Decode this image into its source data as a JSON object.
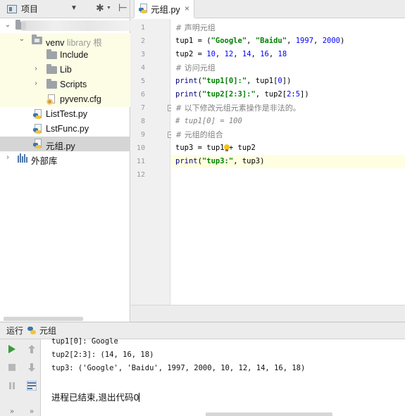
{
  "project_panel": {
    "title": "项目",
    "tree": {
      "venv": {
        "name": "venv",
        "sub": "library 根"
      },
      "include": "Include",
      "lib": "Lib",
      "scripts": "Scripts",
      "pyvenv": "pyvenv.cfg",
      "listtest": "ListTest.py",
      "lstfunc": "LstFunc.py",
      "yuanzu": "元组.py",
      "external": "外部库"
    }
  },
  "editor": {
    "tab_label": "元组.py",
    "line_numbers": [
      "1",
      "2",
      "3",
      "4",
      "5",
      "6",
      "7",
      "8",
      "9",
      "10",
      "11",
      "12"
    ],
    "current_line": 11
  },
  "run_panel": {
    "label": "运行",
    "config_name": "元组",
    "output": [
      "tup1[0]: Google",
      "tup2[2:3]: (14, 16, 18)",
      "tup3: ('Google', 'Baidu', 1997, 2000, 10, 12, 14, 16, 18)"
    ],
    "exit_message": "进程已结束,退出代码0"
  },
  "colors": {
    "string": "#008000",
    "number": "#0000ff",
    "comment": "#808080",
    "current_line": "#fffee0",
    "run_green": "#3a9b3a"
  }
}
